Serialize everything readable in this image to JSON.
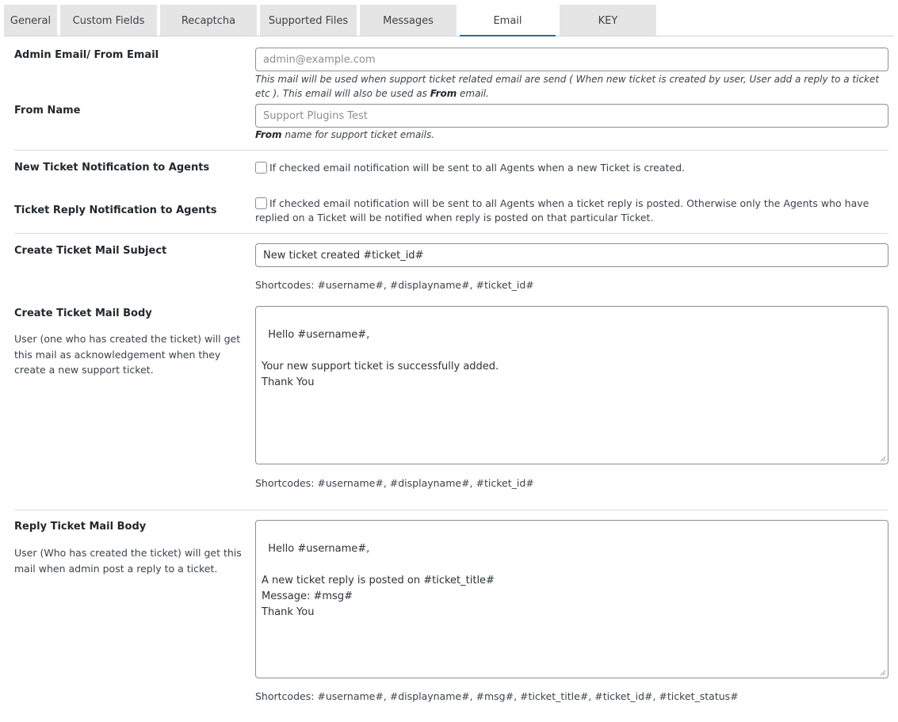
{
  "tabs": [
    {
      "label": "General",
      "active": false
    },
    {
      "label": "Custom Fields",
      "active": false
    },
    {
      "label": "Recaptcha",
      "active": false
    },
    {
      "label": "Supported Files",
      "active": false
    },
    {
      "label": "Messages",
      "active": false
    },
    {
      "label": "Email",
      "active": true
    },
    {
      "label": "KEY",
      "active": false
    }
  ],
  "admin_email": {
    "label": "Admin Email/ From Email",
    "placeholder": "admin@example.com",
    "help_pre": "This mail will be used when support ticket related email are send ( When new ticket is created by user, User add a reply to a ticket etc ). This email will also be used as ",
    "help_bold": "From",
    "help_post": " email."
  },
  "from_name": {
    "label": "From Name",
    "placeholder": "Support Plugins Test",
    "help_bold": "From",
    "help_post": " name for support ticket emails."
  },
  "new_ticket_notification": {
    "label": "New Ticket Notification to Agents",
    "checked": false,
    "description": "If checked email notification will be sent to all Agents when a new Ticket is created."
  },
  "ticket_reply_notification": {
    "label": "Ticket Reply Notification to Agents",
    "checked": false,
    "description": "If checked email notification will be sent to all Agents when a ticket reply is posted. Otherwise only the Agents who have replied on a Ticket will be notified when reply is posted on that particular Ticket."
  },
  "create_subject": {
    "label": "Create Ticket Mail Subject",
    "value": "New ticket created #ticket_id#",
    "shortcodes": "Shortcodes: #username#, #displayname#, #ticket_id#"
  },
  "create_body": {
    "label": "Create Ticket Mail Body",
    "description": "User (one who has created the ticket) will get this mail as acknowledgement when they create a new support ticket.",
    "value": "Hello #username#,\n\nYour new support ticket is successfully added.\nThank You",
    "shortcodes": "Shortcodes: #username#, #displayname#, #ticket_id#"
  },
  "reply_body": {
    "label": "Reply Ticket Mail Body",
    "description": "User (Who has created the ticket) will get this mail when admin post a reply to a ticket.",
    "value": "Hello #username#,\n\nA new ticket reply is posted on #ticket_title#\nMessage: #msg#\nThank You",
    "shortcodes": "Shortcodes: #username#, #displayname#, #msg#, #ticket_title#, #ticket_id#, #ticket_status#"
  },
  "colors": {
    "active_tab_underline": "#2a6f97",
    "tab_background": "#e5e5e5"
  }
}
